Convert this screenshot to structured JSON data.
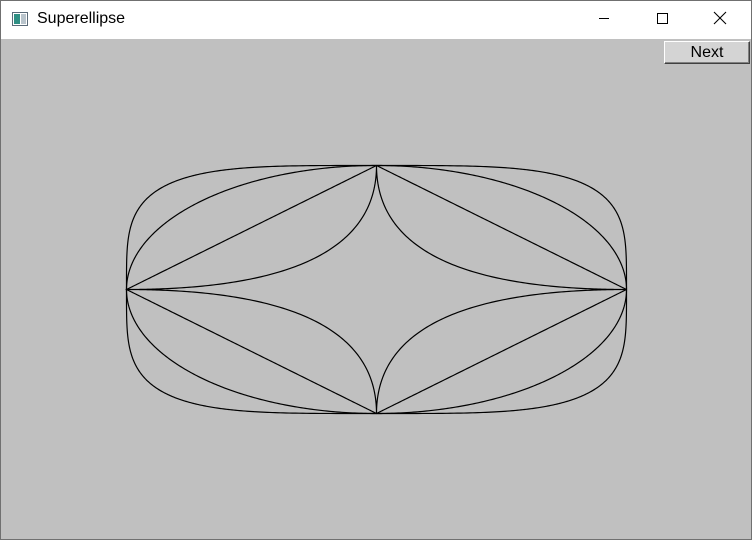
{
  "window": {
    "title": "Superellipse",
    "icon": "app-window-icon",
    "controls": {
      "minimize_icon": "minimize-icon",
      "maximize_icon": "maximize-icon",
      "close_icon": "close-icon"
    }
  },
  "toolbar": {
    "next_label": "Next"
  },
  "drawing": {
    "shape": "superellipse",
    "curve_color": "#000000",
    "background_color": "#c0c0c0",
    "semi_axis_a": 250,
    "semi_axis_b": 124,
    "exponents": [
      0.5,
      1,
      2,
      4
    ]
  }
}
